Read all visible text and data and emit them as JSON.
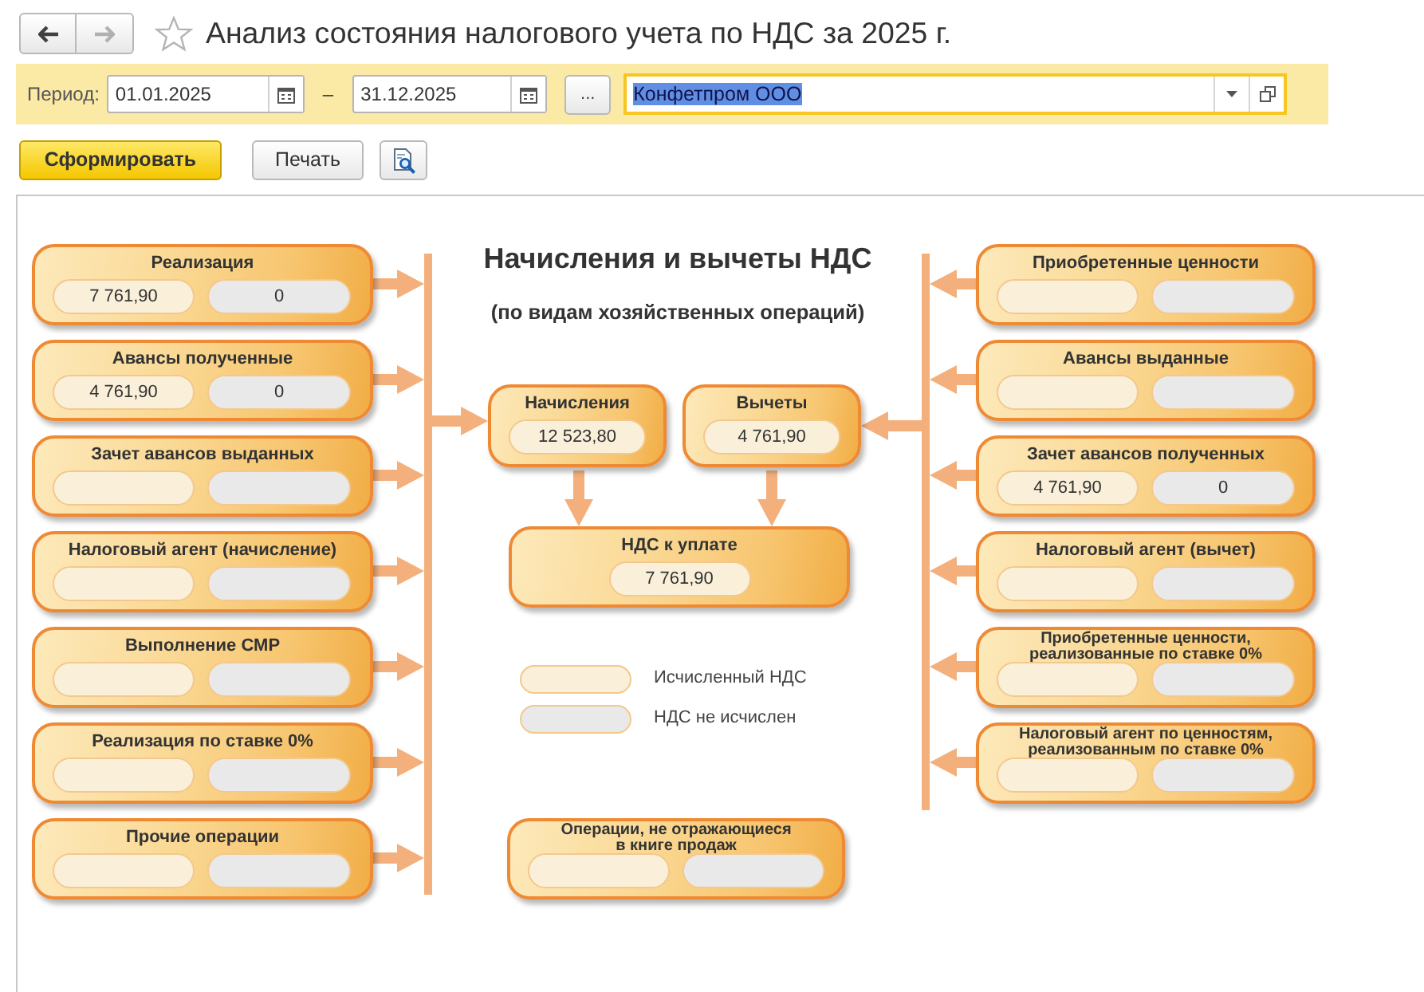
{
  "window": {
    "title": "Анализ состояния налогового учета по НДС за 2025 г.",
    "favorite": false
  },
  "navigation": [
    {
      "kind": "back",
      "disabled": false
    },
    {
      "kind": "forward",
      "disabled": true
    }
  ],
  "filters": {
    "period_label": "Период:",
    "date_from": "01.01.2025",
    "date_separator": "–",
    "date_to": "31.12.2025",
    "period_button": "...",
    "organization": {
      "value": "Конфетпром ООО",
      "focused": true
    }
  },
  "actions": [
    {
      "kind": "primary",
      "label": "Сформировать"
    },
    {
      "kind": "default",
      "label": "Печать"
    },
    {
      "kind": "preview"
    }
  ],
  "report": {
    "title": "Начисления и вычеты НДС",
    "subtitle": "(по видам хозяйственных операций)",
    "accrual_operations": [
      {
        "label": "Реализация",
        "calculated": "7 761,90",
        "not_calculated": "0"
      },
      {
        "label": "Авансы полученные",
        "calculated": "4 761,90",
        "not_calculated": "0"
      },
      {
        "label": "Зачет авансов выданных"
      },
      {
        "label": "Налоговый агент (начисление)"
      },
      {
        "label": "Выполнение СМР"
      },
      {
        "label": "Реализация по ставке 0%"
      },
      {
        "label": "Прочие операции"
      }
    ],
    "deduction_operations": [
      {
        "label": "Приобретенные ценности"
      },
      {
        "label": "Авансы выданные"
      },
      {
        "label": "Зачет авансов полученных",
        "calculated": "4 761,90",
        "not_calculated": "0"
      },
      {
        "label": "Налоговый агент (вычет)"
      },
      {
        "label": "Приобретенные ценности, реализованные по ставке 0%"
      },
      {
        "label": "Налоговый агент по ценностям, реализованным по ставке 0%"
      }
    ],
    "accruals": {
      "label": "Начисления",
      "value": "12 523,80"
    },
    "deductions": {
      "label": "Вычеты",
      "value": "4 761,90"
    },
    "payable": {
      "label": "НДС к уплате",
      "value": "7 761,90"
    },
    "legend": [
      {
        "kind": "calculated",
        "label": "Исчисленный НДС"
      },
      {
        "kind": "not_calculated",
        "label": "НДС не исчислен"
      }
    ],
    "excluded_operations": {
      "label": "Операции, не отражающиеся в книге продаж"
    }
  }
}
